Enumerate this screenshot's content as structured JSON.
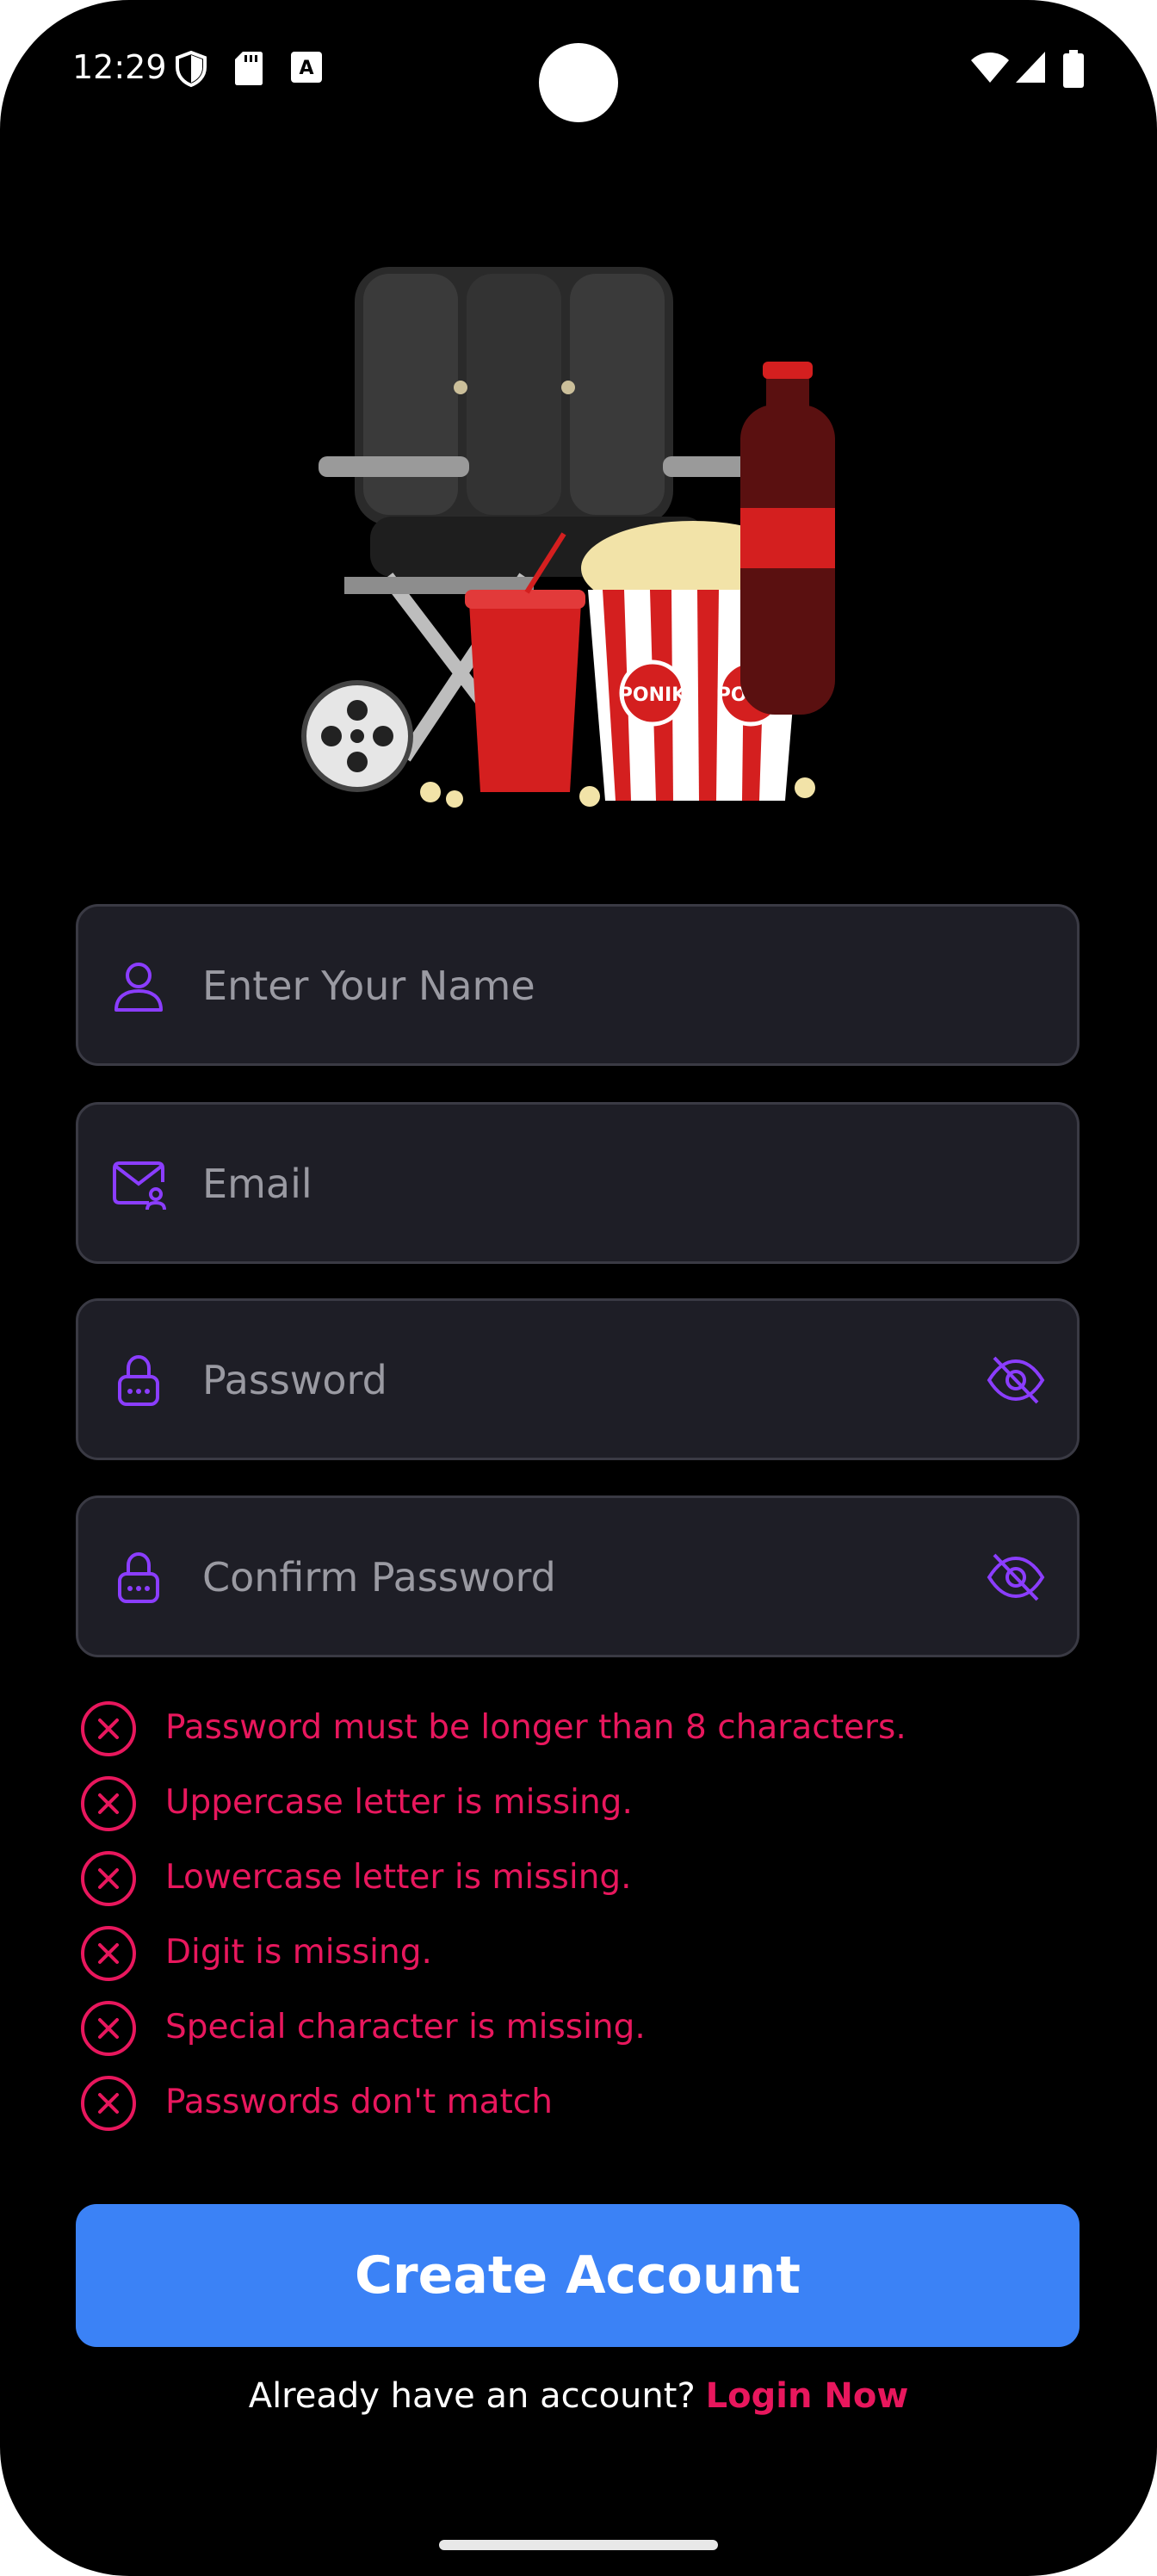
{
  "status_bar": {
    "time": "12:29",
    "icons_left": [
      "shield-icon",
      "sd-card-icon",
      "keyboard-a-icon"
    ],
    "icons_right": [
      "wifi-icon",
      "signal-icon",
      "battery-icon"
    ]
  },
  "hero": {
    "image": "cinema-seat-popcorn-illustration",
    "popcorn_label": "PONIK"
  },
  "form": {
    "name": {
      "placeholder": "Enter Your Name",
      "value": "",
      "icon": "user-icon"
    },
    "email": {
      "placeholder": "Email",
      "value": "",
      "icon": "mail-user-icon"
    },
    "password": {
      "placeholder": "Password",
      "value": "",
      "icon": "lock-icon",
      "toggle_icon": "eye-off-icon"
    },
    "confirm_password": {
      "placeholder": "Confirm Password",
      "value": "",
      "icon": "lock-icon",
      "toggle_icon": "eye-off-icon"
    }
  },
  "validation_errors": [
    "Password must be longer than 8 characters.",
    "Uppercase letter is missing.",
    "Lowercase letter is missing.",
    "Digit is missing.",
    "Special character is missing.",
    "Passwords don't match"
  ],
  "actions": {
    "create_account": "Create Account",
    "login_prompt": "Already have an account?",
    "login_link": "Login Now"
  },
  "colors": {
    "background": "#000000",
    "field_bg": "#1e1e26",
    "accent_icon": "#8b3dff",
    "error": "#e8175d",
    "primary_button": "#3b82f6"
  }
}
